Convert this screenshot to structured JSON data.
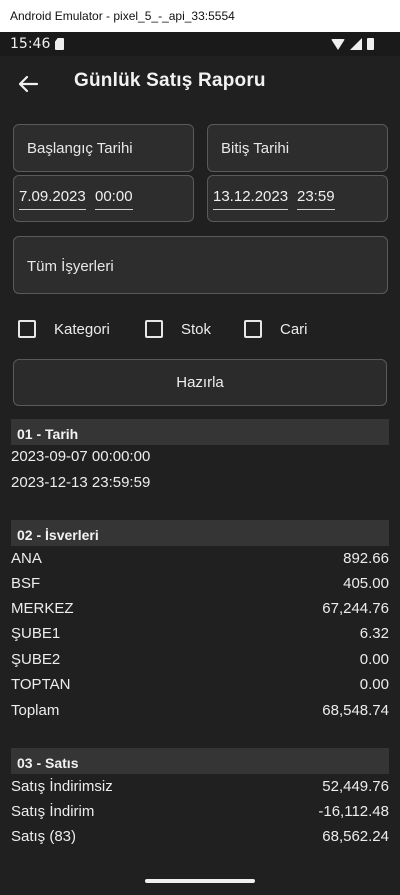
{
  "window": {
    "title": "Android Emulator - pixel_5_-_api_33:5554"
  },
  "status_bar": {
    "time": "15:46"
  },
  "app_bar": {
    "title": "Günlük Satış Raporu"
  },
  "filters": {
    "start_label": "Başlangıç Tarihi",
    "end_label": "Bitiş Tarihi",
    "start_date": "7.09.2023",
    "start_time": "00:00",
    "end_date": "13.12.2023",
    "end_time": "23:59",
    "workplace_label": "Tüm İşyerleri",
    "checkboxes": [
      {
        "label": "Kategori",
        "checked": false
      },
      {
        "label": "Stok",
        "checked": false
      },
      {
        "label": "Cari",
        "checked": false
      }
    ],
    "prepare_button": "Hazırla"
  },
  "sections": {
    "date": {
      "title": "01 - Tarih",
      "lines": [
        "2023-09-07 00:00:00",
        "2023-12-13 23:59:59"
      ]
    },
    "workplaces": {
      "title": "02 - İsverleri",
      "rows": [
        {
          "name": "ANA",
          "value": "892.66"
        },
        {
          "name": "BSF",
          "value": "405.00"
        },
        {
          "name": "MERKEZ",
          "value": "67,244.76"
        },
        {
          "name": "ŞUBE1",
          "value": "6.32"
        },
        {
          "name": "ŞUBE2",
          "value": "0.00"
        },
        {
          "name": "TOPTAN",
          "value": "0.00"
        },
        {
          "name": "Toplam",
          "value": "68,548.74"
        }
      ]
    },
    "sales": {
      "title": "03 - Satıs",
      "rows": [
        {
          "name": "Satış İndirimsiz",
          "value": "52,449.76"
        },
        {
          "name": "Satış İndirim",
          "value": "-16,112.48"
        },
        {
          "name": "Satış (83)",
          "value": "68,562.24"
        }
      ]
    }
  }
}
